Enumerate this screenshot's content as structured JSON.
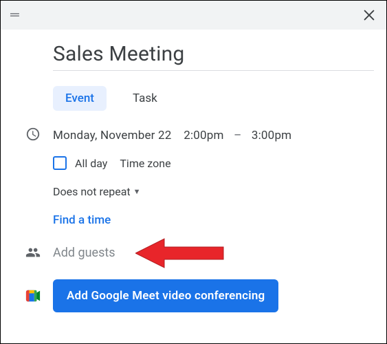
{
  "header": {},
  "title": "Sales Meeting",
  "tabs": {
    "event": "Event",
    "task": "Task"
  },
  "datetime": {
    "date": "Monday, November 22",
    "start": "2:00pm",
    "end": "3:00pm",
    "separator": "–"
  },
  "options": {
    "all_day": "All day",
    "time_zone": "Time zone",
    "repeat": "Does not repeat",
    "find_a_time": "Find a time"
  },
  "guests": {
    "placeholder": "Add guests"
  },
  "meet": {
    "button": "Add Google Meet video conferencing"
  }
}
